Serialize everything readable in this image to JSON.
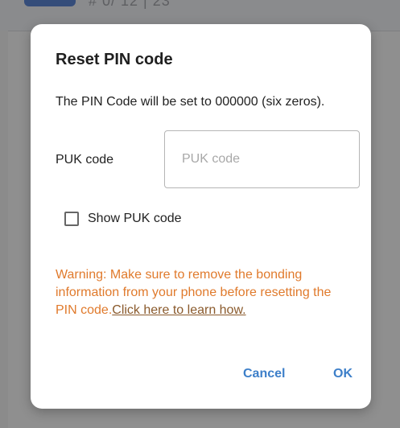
{
  "background": {
    "header_text": "# 0/ 12 | 23"
  },
  "dialog": {
    "title": "Reset PIN code",
    "description": "The PIN Code will be set to 000000 (six zeros).",
    "puk_label": "PUK code",
    "puk_input": {
      "value": "",
      "placeholder": "PUK code"
    },
    "show_puk": {
      "label": "Show PUK code",
      "checked": false
    },
    "warning_text": "Warning: Make sure to remove the bonding information from your phone before resetting the PIN code.",
    "warning_link": "Click here to learn how.",
    "cancel_label": "Cancel",
    "ok_label": "OK"
  },
  "colors": {
    "warning": "#e07a2c",
    "link": "#8a5a2c",
    "accent": "#3d7fc9",
    "scrim": "#8f8f8f"
  }
}
